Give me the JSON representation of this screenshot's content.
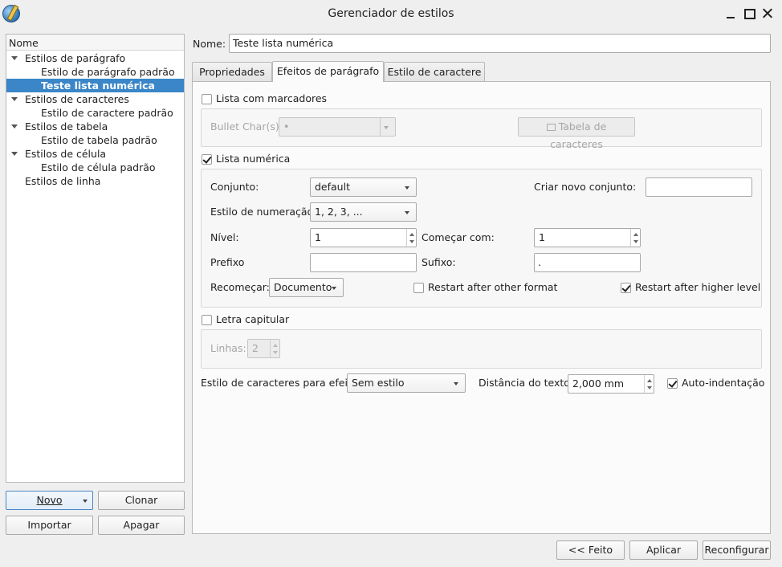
{
  "window": {
    "title": "Gerenciador de estilos"
  },
  "tree": {
    "header": "Nome",
    "items": [
      {
        "label": "Estilos de parágrafo"
      },
      {
        "label": "Estilo de parágrafo padrão"
      },
      {
        "label": "Teste lista numérica"
      },
      {
        "label": "Estilos de caracteres"
      },
      {
        "label": "Estilo de caractere padrão"
      },
      {
        "label": "Estilos de tabela"
      },
      {
        "label": "Estilo de tabela padrão"
      },
      {
        "label": "Estilos de célula"
      },
      {
        "label": "Estilo de célula padrão"
      },
      {
        "label": "Estilos de linha"
      }
    ]
  },
  "left_buttons": {
    "novo": "Novo",
    "clonar": "Clonar",
    "importar": "Importar",
    "apagar": "Apagar"
  },
  "name_field": {
    "label": "Nome:",
    "value": "Teste lista numérica"
  },
  "tabs": [
    {
      "label": "Propriedades"
    },
    {
      "label": "Efeitos de parágrafo"
    },
    {
      "label": "Estilo de caractere"
    }
  ],
  "bullets": {
    "checkbox_label": "Lista com marcadores",
    "bullet_char_label": "Bullet Char(s):",
    "bullet_char_value": "•",
    "table_button": "Tabela de caracteres"
  },
  "numbered": {
    "checkbox_label": "Lista numérica",
    "conjunto_label": "Conjunto:",
    "conjunto_value": "default",
    "criar_label": "Criar novo conjunto:",
    "criar_value": "",
    "estilo_label": "Estilo de numeração:",
    "estilo_value": "1, 2, 3, ...",
    "nivel_label": "Nível:",
    "nivel_value": "1",
    "comecar_label": "Começar com:",
    "comecar_value": "1",
    "prefixo_label": "Prefixo",
    "prefixo_value": "",
    "sufixo_label": "Sufixo:",
    "sufixo_value": ".",
    "recomecar_label": "Recomeçar:",
    "recomecar_value": "Documento",
    "restart_other": "Restart after other format",
    "restart_higher": "Restart after higher level"
  },
  "dropcap": {
    "checkbox_label": "Letra capitular",
    "linhas_label": "Linhas:",
    "linhas_value": "2"
  },
  "effects": {
    "char_style_label": "Estilo de caracteres para efeito:",
    "char_style_value": "Sem estilo",
    "distance_label": "Distância do texto:",
    "distance_value": "2,000 mm",
    "auto_indent": "Auto-indentação"
  },
  "bottom_buttons": {
    "feito": "<< Feito",
    "aplicar": "Aplicar",
    "reconfigurar": "Reconfigurar"
  }
}
